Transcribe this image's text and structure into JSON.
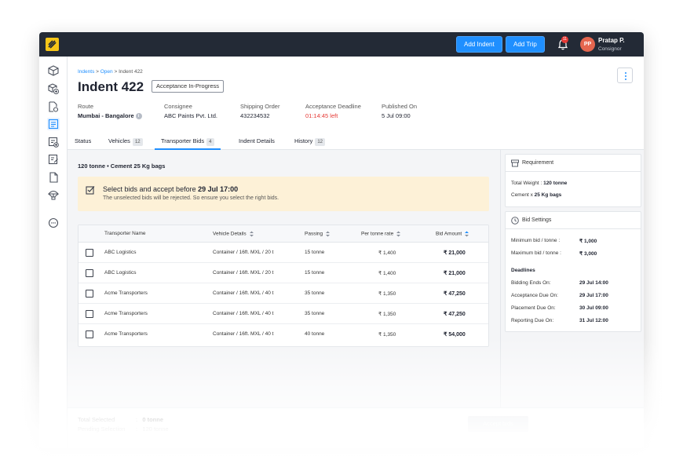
{
  "topbar": {
    "add_indent": "Add Indent",
    "add_trip": "Add Trip",
    "notification_count": "11",
    "avatar_initials": "PP",
    "user_name": "Pratap P.",
    "user_role": "Consignor"
  },
  "sidebar": {
    "icons": [
      "cube-icon",
      "cube-add-icon",
      "file-settings-icon",
      "list-icon",
      "list-add-icon",
      "edit-icon",
      "document-icon",
      "parachute-icon",
      "chat-icon"
    ],
    "active": "list-icon"
  },
  "header": {
    "breadcrumb": [
      "Indents",
      "Open",
      "Indent 422"
    ],
    "title": "Indent 422",
    "status": "Acceptance In-Progress",
    "meta": [
      {
        "label": "Route",
        "value": "Mumbai - Bangalore"
      },
      {
        "label": "Consignee",
        "value": "ABC Paints Pvt. Ltd."
      },
      {
        "label": "Shipping Order",
        "value": "432234532"
      },
      {
        "label": "Acceptance Deadline",
        "value": "01:14:45 left"
      },
      {
        "label": "Published On",
        "value": "5 Jul 09:00"
      }
    ],
    "tabs": [
      {
        "label": "Status",
        "count": ""
      },
      {
        "label": "Vehicles",
        "count": "12"
      },
      {
        "label": "Transporter Bids",
        "count": "4"
      },
      {
        "label": "Indent Details",
        "count": ""
      },
      {
        "label": "History",
        "count": "12"
      }
    ]
  },
  "main": {
    "cargo": "120 tonne  •  Cement 25 Kg bags",
    "notice": {
      "title_prefix": "Select bids and accept before ",
      "title_date": "29 Jul 17:00",
      "subtitle": "The unselected bids will be rejected. So ensure you select the right bids."
    },
    "table": {
      "columns": [
        "Transporter Name",
        "Vehicle Details",
        "Passing",
        "Per tonne rate",
        "Bid Amount"
      ],
      "rows": [
        [
          "ABC Logistics",
          "Container / 16ft. MXL / 20 t",
          "15 tonne",
          "₹ 1,400",
          "₹ 21,000"
        ],
        [
          "ABC Logistics",
          "Container / 16ft. MXL / 20 t",
          "15 tonne",
          "₹ 1,400",
          "₹ 21,000"
        ],
        [
          "Acme Transporters",
          "Container / 16ft. MXL / 40 t",
          "35 tonne",
          "₹ 1,350",
          "₹ 47,250"
        ],
        [
          "Acme Transporters",
          "Container / 16ft. MXL / 40 t",
          "35 tonne",
          "₹ 1,350",
          "₹ 47,250"
        ],
        [
          "Acme Transporters",
          "Container / 16ft. MXL / 40 t",
          "40 tonne",
          "₹ 1,350",
          "₹ 54,000"
        ]
      ]
    }
  },
  "requirement": {
    "title": "Requirement",
    "total_weight_label": "Total Weight : ",
    "total_weight": "120 tonne",
    "material_label": "Cement x ",
    "material": "25 Kg bags"
  },
  "bid_settings": {
    "title": "Bid Settings",
    "min_label": "Minimum bid / tonne :",
    "min_value": "₹ 1,000",
    "max_label": "Maximum bid / tonne :",
    "max_value": "₹ 3,000",
    "deadlines_title": "Deadlines",
    "deadlines": [
      {
        "label": "Bidding Ends On:",
        "value": "29 Jul 14:00"
      },
      {
        "label": "Acceptance Due On:",
        "value": "29 Jul 17:00"
      },
      {
        "label": "Placement Due On:",
        "value": "30 Jul 09:00"
      },
      {
        "label": "Reporting Due On:",
        "value": "31 Jul 12:00"
      }
    ]
  },
  "footer": {
    "total_selected_label": "Total Selected",
    "total_selected_value": "0 tonne",
    "pending_label": "Pending Selection",
    "pending_value": "120 tonne",
    "accept_button": "Accept bids"
  },
  "colors": {
    "accent": "#1f8fff",
    "topbar": "#232a36",
    "deadline_red": "#e53935",
    "notice_bg": "#fdf1d7",
    "logo": "#f5c518"
  }
}
